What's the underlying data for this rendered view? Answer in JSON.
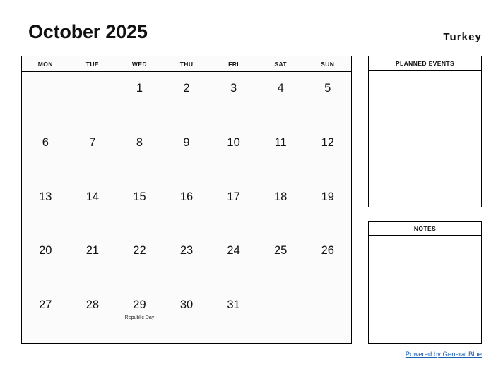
{
  "header": {
    "month_title": "October 2025",
    "country": "Turkey"
  },
  "calendar": {
    "weekdays": [
      "MON",
      "TUE",
      "WED",
      "THU",
      "FRI",
      "SAT",
      "SUN"
    ],
    "weeks": [
      [
        {
          "day": "",
          "event": ""
        },
        {
          "day": "",
          "event": ""
        },
        {
          "day": "1",
          "event": ""
        },
        {
          "day": "2",
          "event": ""
        },
        {
          "day": "3",
          "event": ""
        },
        {
          "day": "4",
          "event": ""
        },
        {
          "day": "5",
          "event": ""
        }
      ],
      [
        {
          "day": "6",
          "event": ""
        },
        {
          "day": "7",
          "event": ""
        },
        {
          "day": "8",
          "event": ""
        },
        {
          "day": "9",
          "event": ""
        },
        {
          "day": "10",
          "event": ""
        },
        {
          "day": "11",
          "event": ""
        },
        {
          "day": "12",
          "event": ""
        }
      ],
      [
        {
          "day": "13",
          "event": ""
        },
        {
          "day": "14",
          "event": ""
        },
        {
          "day": "15",
          "event": ""
        },
        {
          "day": "16",
          "event": ""
        },
        {
          "day": "17",
          "event": ""
        },
        {
          "day": "18",
          "event": ""
        },
        {
          "day": "19",
          "event": ""
        }
      ],
      [
        {
          "day": "20",
          "event": ""
        },
        {
          "day": "21",
          "event": ""
        },
        {
          "day": "22",
          "event": ""
        },
        {
          "day": "23",
          "event": ""
        },
        {
          "day": "24",
          "event": ""
        },
        {
          "day": "25",
          "event": ""
        },
        {
          "day": "26",
          "event": ""
        }
      ],
      [
        {
          "day": "27",
          "event": ""
        },
        {
          "day": "28",
          "event": ""
        },
        {
          "day": "29",
          "event": "Republic Day"
        },
        {
          "day": "30",
          "event": ""
        },
        {
          "day": "31",
          "event": ""
        },
        {
          "day": "",
          "event": ""
        },
        {
          "day": "",
          "event": ""
        }
      ]
    ]
  },
  "panels": {
    "planned_events": {
      "title": "PLANNED EVENTS",
      "content": ""
    },
    "notes": {
      "title": "NOTES",
      "content": ""
    }
  },
  "footer": {
    "link_text": "Powered by General Blue"
  },
  "colors": {
    "link": "#1a5fb4",
    "border": "#000000",
    "cell_background": "#fbfbfb",
    "page_background": "#ffffff"
  }
}
